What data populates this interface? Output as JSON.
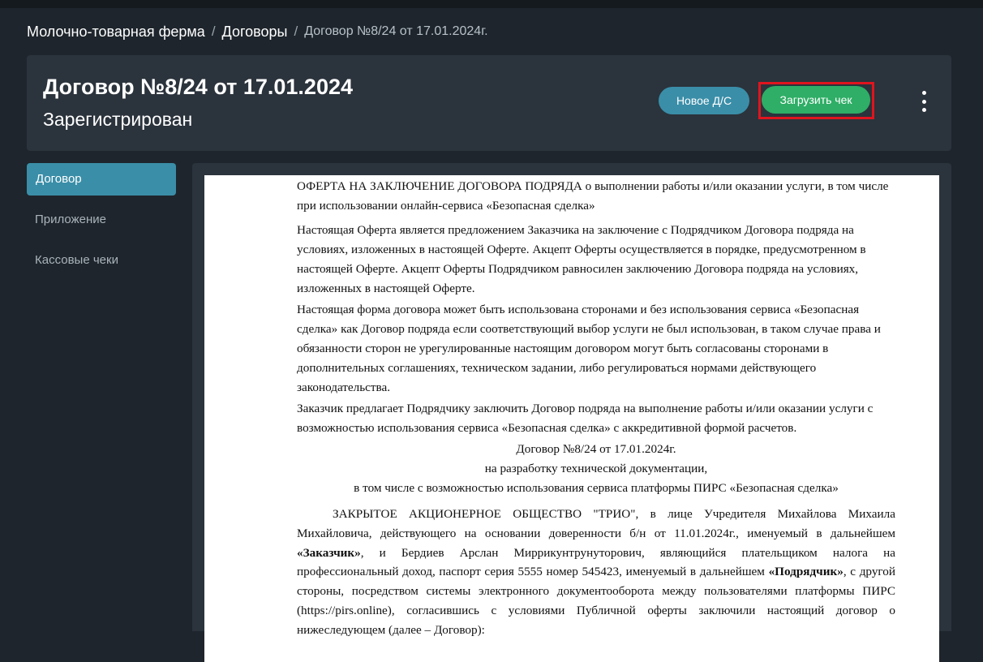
{
  "breadcrumb": {
    "items": [
      "Молочно-товарная ферма",
      "Договоры"
    ],
    "current": "Договор №8/24 от 17.01.2024г.",
    "separator": "/"
  },
  "header": {
    "title": "Договор №8/24 от 17.01.2024",
    "status": "Зарегистрирован",
    "new_ds_label": "Новое Д/С",
    "upload_label": "Загрузить чек"
  },
  "sidebar": {
    "items": [
      {
        "label": "Договор",
        "active": true
      },
      {
        "label": "Приложение",
        "active": false
      },
      {
        "label": "Кассовые чеки",
        "active": false
      }
    ]
  },
  "document": {
    "heading": "ОФЕРТА НА ЗАКЛЮЧЕНИЕ ДОГОВОРА ПОДРЯДА о выполнении работы и/или оказании услуги, в том числе при использовании онлайн-сервиса «Безопасная сделка»",
    "para1": "Настоящая Оферта является предложением Заказчика на заключение с Подрядчиком Договора подряда на условиях, изложенных в настоящей Оферте. Акцепт Оферты осуществляется в порядке, предусмотренном в настоящей Оферте. Акцепт Оферты Подрядчиком равносилен заключению Договора подряда на условиях, изложенных в настоящей Оферте.",
    "para2": "Настоящая форма договора может быть использована сторонами и без использования сервиса «Безопасная сделка» как Договор подряда если соответствующий выбор услуги не был использован, в таком случае права и обязанности сторон не урегулированные настоящим договором могут быть согласованы сторонами в дополнительных соглашениях, техническом задании, либо регулироваться нормами действующего законодательства.",
    "para3": "Заказчик предлагает Подрядчику заключить Договор подряда на выполнение работы и/или оказании услуги с возможностью использования сервиса «Безопасная сделка» с аккредитивной формой расчетов.",
    "title_line1": "Договор №8/24 от 17.01.2024г.",
    "title_line2": "на разработку технической документации,",
    "title_line3": "в том числе с возможностью использования сервиса платформы ПИРС «Безопасная сделка»",
    "body_part1": "ЗАКРЫТОЕ АКЦИОНЕРНОЕ ОБЩЕСТВО \"ТРИО\", в лице Учредителя Михайлова Михаила Михайловича, действующего на основании доверенности б/н от 11.01.2024г., именуемый в дальнейшем ",
    "body_bold1": "«Заказчик»",
    "body_part2": ", и Бердиев Арслан Миррикунтрунуторович, являющийся плательщиком налога на профессиональный доход, паспорт серия 5555 номер 545423, именуемый в дальнейшем ",
    "body_bold2": "«Подрядчик»",
    "body_part3": ", с другой стороны, посредством системы электронного документооборота между пользователями платформы ПИРС (https://pirs.online), согласившись с условиями Публичной оферты заключили настоящий договор о нижеследующем (далее – Договор):"
  }
}
